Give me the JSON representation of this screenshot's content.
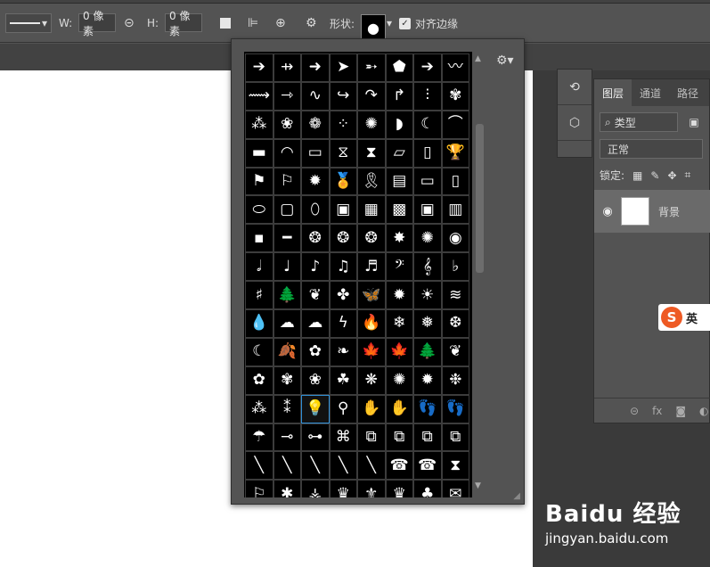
{
  "options_bar": {
    "w_label": "W:",
    "w_value": "0 像素",
    "h_label": "H:",
    "h_value": "0 像素",
    "shape_label": "形状:",
    "align_edges_label": "对齐边缘",
    "align_edges_checked": true
  },
  "shape_picker": {
    "selected_shape": "light-bulb",
    "shapes": [
      "➔",
      "⇸",
      "➜",
      "➤",
      "➵",
      "⬟",
      "➔",
      "〰",
      "⟿",
      "⇾",
      "∿",
      "↪",
      "↷",
      "↱",
      "⫶",
      "✾",
      "⁂",
      "❀",
      "❁",
      "⁘",
      "✺",
      "◗",
      "☾",
      "⌒",
      "▬",
      "◠",
      "▭",
      "⧖",
      "⧗",
      "▱",
      "▯",
      "🏆",
      "⚑",
      "⚐",
      "✹",
      "🏅",
      "🎗",
      "▤",
      "▭",
      "▯",
      "⬭",
      "▢",
      "⬯",
      "▣",
      "▦",
      "▩",
      "▣",
      "▥",
      "▪",
      "━",
      "❂",
      "❂",
      "❂",
      "✸",
      "✺",
      "◉",
      "𝅗𝅥",
      "♩",
      "♪",
      "♫",
      "♬",
      "𝄢",
      "𝄞",
      "♭",
      "♯",
      "🌲",
      "❦",
      "✤",
      "🦋",
      "✹",
      "☀",
      "≋",
      "💧",
      "☁",
      "☁",
      "ϟ",
      "🔥",
      "❄",
      "❅",
      "❆",
      "☾",
      "🍂",
      "✿",
      "❧",
      "🍁",
      "🍁",
      "🌲",
      "❦",
      "✿",
      "✾",
      "❀",
      "☘",
      "❋",
      "✺",
      "✹",
      "❉",
      "⁂",
      "⁑",
      "💡",
      "⚲",
      "✋",
      "✋",
      "👣",
      "👣",
      "☂",
      "⊸",
      "⊶",
      "⌘",
      "⧉",
      "⧉",
      "⧉",
      "⧉",
      "╲",
      "╲",
      "╲",
      "╲",
      "╲",
      "☎",
      "☎",
      "⧗",
      "⚐",
      "✱",
      "⚶",
      "♛",
      "⚜",
      "♛",
      "♣",
      "✉"
    ]
  },
  "dock_icons": [
    "history-icon",
    "3d-icon"
  ],
  "layers_panel": {
    "tabs": [
      "图层",
      "通道",
      "路径"
    ],
    "active_tab": "图层",
    "filter_label": "类型",
    "blend_mode": "正常",
    "lock_label": "锁定:",
    "layer_name": "背景"
  },
  "ime": {
    "text": "英"
  },
  "watermark": {
    "main": "Baidu 经验",
    "sub": "jingyan.baidu.com"
  }
}
